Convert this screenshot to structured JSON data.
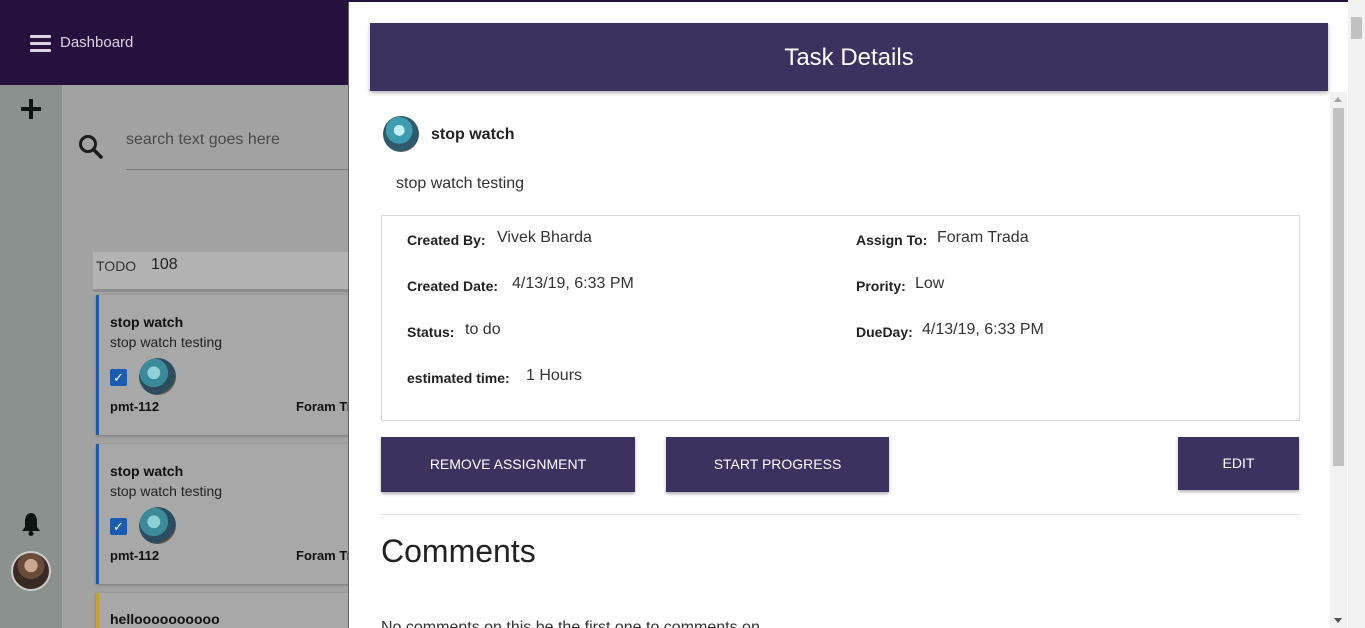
{
  "topbar": {
    "title": "Dashboard"
  },
  "search": {
    "placeholder": "search text goes here"
  },
  "column": {
    "label": "TODO",
    "count": "108"
  },
  "cards": [
    {
      "title": "stop watch",
      "desc": "stop watch testing",
      "id": "pmt-112",
      "assignee": "Foram Tr"
    },
    {
      "title": "stop watch",
      "desc": "stop watch testing",
      "id": "pmt-112",
      "assignee": "Foram Tr"
    },
    {
      "title": "helloooooooooo"
    }
  ],
  "task": {
    "header": "Task Details",
    "name": "stop watch",
    "description": "stop watch testing",
    "fields": {
      "created_by_label": "Created By:",
      "created_by": "Vivek Bharda",
      "assign_to_label": "Assign To:",
      "assign_to": "Foram Trada",
      "created_date_label": "Created Date:",
      "created_date": "4/13/19, 6:33 PM",
      "priority_label": "Prority:",
      "priority": "Low",
      "status_label": "Status:",
      "status": "to do",
      "due_label": "DueDay:",
      "due": "4/13/19, 6:33 PM",
      "estimate_label": "estimated time:",
      "estimate": "1 Hours"
    },
    "buttons": {
      "remove": "REMOVE ASSIGNMENT",
      "start": "START PROGRESS",
      "edit": "EDIT"
    },
    "comments_title": "Comments",
    "comments_empty": "No comments on this be the first one to comments on"
  },
  "colors": {
    "topbar": "#26103d",
    "panel_header": "#3d3160",
    "card_border_blue": "#1f5aa6",
    "card_border_yellow": "#c9a227"
  },
  "icons": [
    "menu-icon",
    "plus-icon",
    "search-icon",
    "bell-icon",
    "checkbox-icon"
  ]
}
